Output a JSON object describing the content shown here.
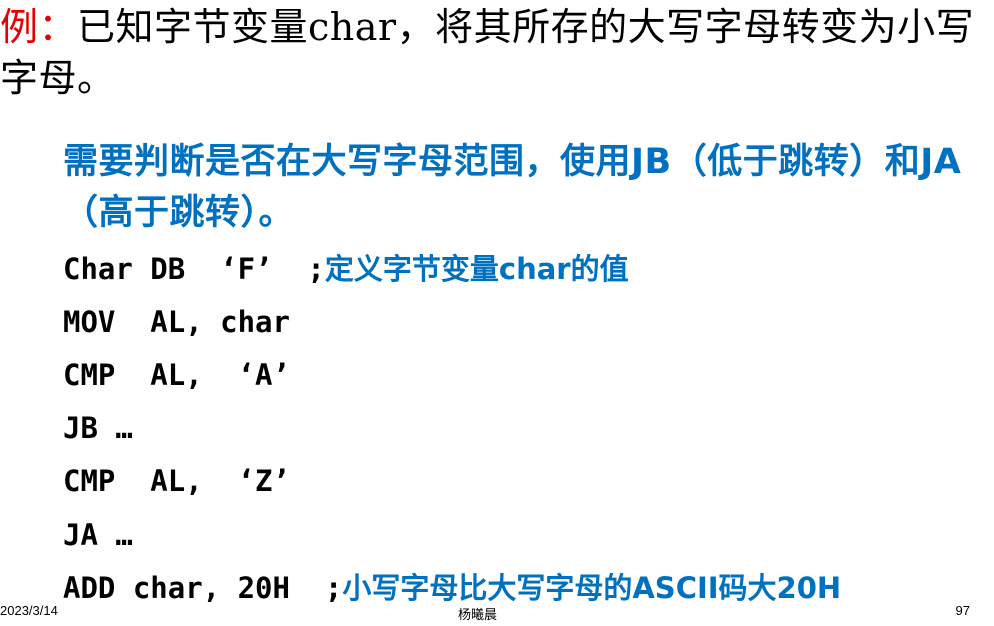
{
  "slide": {
    "title": {
      "prefix": "例：",
      "text": "已知字节变量char，将其所存的大写字母转变为小写字母。"
    },
    "note": "需要判断是否在大写字母范围，使用JB（低于跳转）和JA（高于跳转）。",
    "code_lines": [
      {
        "code": "Char DB  ‘F’  ;",
        "comment": "定义字节变量char的值"
      },
      {
        "code": "MOV  AL, char",
        "comment": ""
      },
      {
        "code": "CMP  AL,  ‘A’",
        "comment": ""
      },
      {
        "code": "JB …",
        "comment": ""
      },
      {
        "code": "CMP  AL,  ‘Z’",
        "comment": ""
      },
      {
        "code": "JA …",
        "comment": ""
      },
      {
        "code": "ADD char, 20H  ;",
        "comment": "小写字母比大写字母的ASCII码大20H"
      }
    ]
  },
  "footer": {
    "date": "2023/3/14",
    "author": "杨曦晨",
    "page_number": "97"
  },
  "colors": {
    "title_prefix": "#e60000",
    "accent_blue": "#0070c0",
    "text": "#000000",
    "background": "#ffffff"
  }
}
